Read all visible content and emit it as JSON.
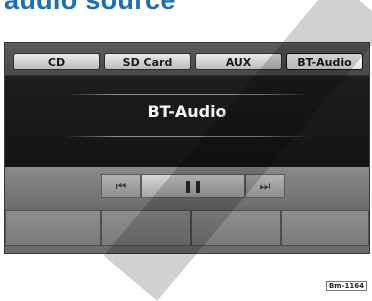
{
  "page": {
    "heading": "audio source"
  },
  "tabs": [
    {
      "label": "CD",
      "active": false
    },
    {
      "label": "SD Card",
      "active": false
    },
    {
      "label": "AUX",
      "active": false
    },
    {
      "label": "BT-Audio",
      "active": true
    }
  ],
  "display": {
    "title": "BT-Audio"
  },
  "controls": {
    "previous": {
      "icon": "skip-previous-icon",
      "glyph": "⏮"
    },
    "play_pause": {
      "icon": "pause-icon",
      "glyph": "❚❚"
    },
    "next": {
      "icon": "skip-next-icon",
      "glyph": "⏭"
    }
  },
  "figure": {
    "ref_code": "Bm-1164"
  },
  "colors": {
    "heading": "#1c6fb0",
    "screen": "#6b6b6b",
    "display": "#1a1a1a"
  }
}
